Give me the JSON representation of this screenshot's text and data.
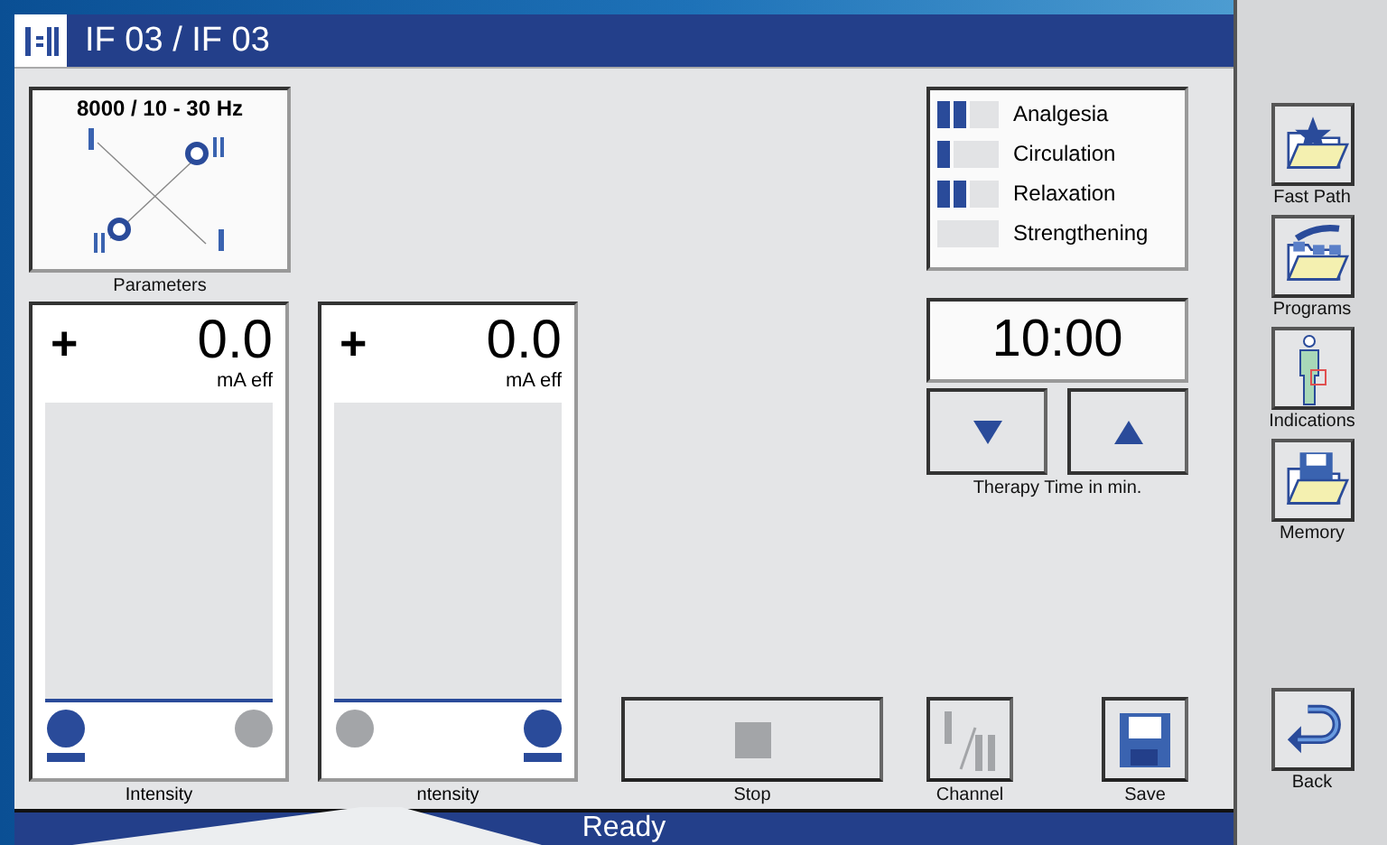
{
  "window": {
    "title": "IF 03 / IF 03"
  },
  "parameters": {
    "frequency": "8000 / 10 - 30 Hz",
    "label": "Parameters"
  },
  "channels": [
    {
      "sign": "+",
      "value": "0.0",
      "unit": "mA eff",
      "level": 0,
      "label": "Intensity",
      "electrodes": [
        {
          "selected": true
        },
        {
          "selected": false
        }
      ]
    },
    {
      "sign": "+",
      "value": "0.0",
      "unit": "mA eff",
      "level": 0,
      "label": "ntensity",
      "electrodes": [
        {
          "selected": false
        },
        {
          "selected": true
        }
      ]
    }
  ],
  "indications": [
    {
      "name": "Analgesia",
      "level": 0.5
    },
    {
      "name": "Circulation",
      "level": 0.25
    },
    {
      "name": "Relaxation",
      "level": 0.5
    },
    {
      "name": "Strengthening",
      "level": 0
    }
  ],
  "timer": {
    "value": "10:00",
    "label": "Therapy Time in min."
  },
  "bottom_buttons": [
    {
      "kind": "stop",
      "label": "Stop",
      "disabled": true
    },
    {
      "kind": "channel",
      "label": "Channel",
      "disabled": true
    },
    {
      "kind": "save",
      "label": "Save",
      "disabled": false
    }
  ],
  "status_bar": "Ready",
  "sidebar": [
    {
      "kind": "fast-path",
      "label": "Fast Path"
    },
    {
      "kind": "programs",
      "label": "Programs"
    },
    {
      "kind": "indications",
      "label": "Indications"
    },
    {
      "kind": "memory",
      "label": "Memory"
    },
    {
      "kind": "back",
      "label": "Back"
    }
  ]
}
